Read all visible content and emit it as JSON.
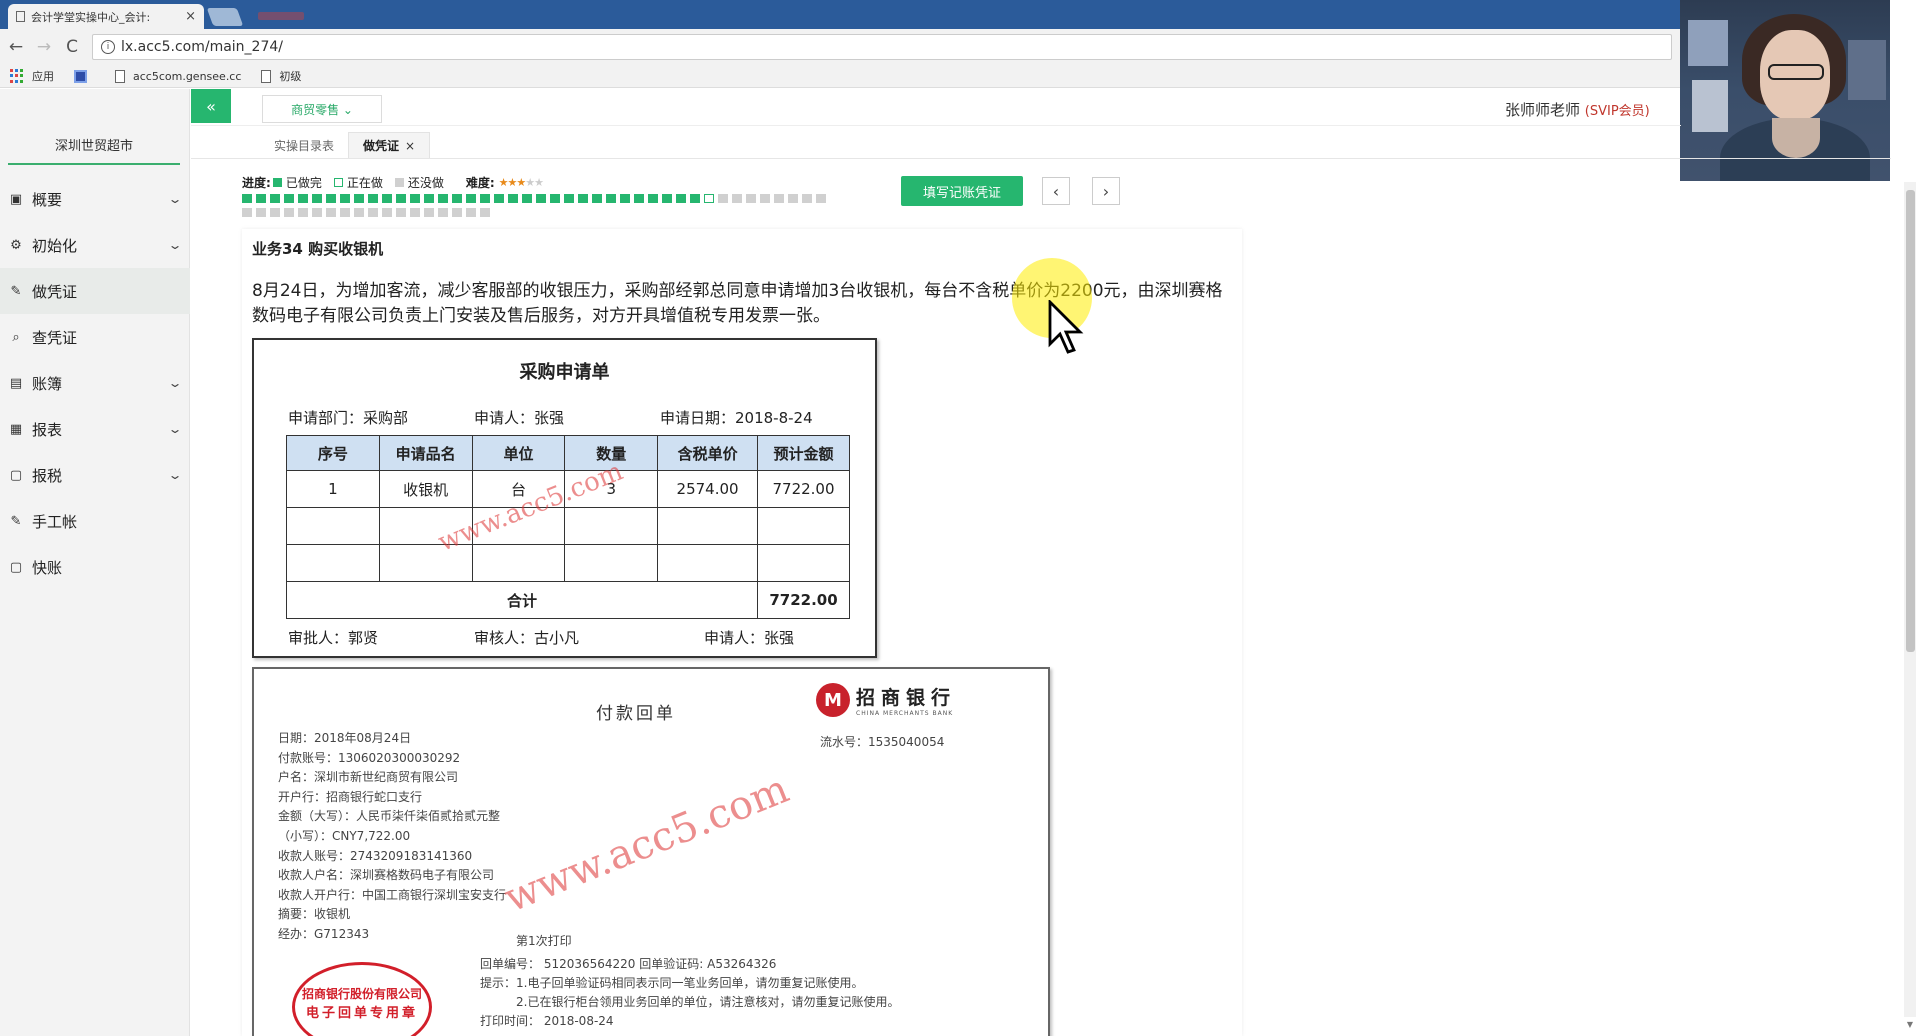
{
  "browser": {
    "tab_title": "会计学堂实操中心_会计:",
    "tab_close": "×",
    "url": "lx.acc5.com/main_274/",
    "back": "←",
    "forward": "→",
    "reload": "C",
    "bookmarks": [
      {
        "label": "应用",
        "icon": "apps-icon"
      },
      {
        "label": "",
        "icon": "square-icon"
      },
      {
        "label": "acc5com.gensee.cc",
        "icon": "page-icon"
      },
      {
        "label": "初级",
        "icon": "page-icon"
      }
    ]
  },
  "sidebar": {
    "company": "深圳世贸超市",
    "items": [
      {
        "label": "概要",
        "icon": "grid-icon",
        "glyph": "▣",
        "expandable": true
      },
      {
        "label": "初始化",
        "icon": "gear-icon",
        "glyph": "⚙",
        "expandable": true
      },
      {
        "label": "做凭证",
        "icon": "pen-icon",
        "glyph": "✎",
        "expandable": false,
        "active": true
      },
      {
        "label": "查凭证",
        "icon": "search-icon",
        "glyph": "⌕",
        "expandable": false
      },
      {
        "label": "账簿",
        "icon": "book-icon",
        "glyph": "▤",
        "expandable": true
      },
      {
        "label": "报表",
        "icon": "report-icon",
        "glyph": "▦",
        "expandable": true
      },
      {
        "label": "报税",
        "icon": "file-icon",
        "glyph": "▢",
        "expandable": true
      },
      {
        "label": "手工帐",
        "icon": "pen-icon",
        "glyph": "✎",
        "expandable": false
      },
      {
        "label": "快账",
        "icon": "file-icon",
        "glyph": "▢",
        "expandable": false
      }
    ]
  },
  "header": {
    "collapse": "«",
    "dropdown": "商贸零售 ⌄",
    "user": "张师师老师",
    "vip": "(SVIP会员)"
  },
  "tabs": [
    {
      "label": "实操目录表",
      "active": false
    },
    {
      "label": "做凭证",
      "active": true,
      "close": "×"
    }
  ],
  "progress": {
    "label": "进度:",
    "legend": [
      "已做完",
      "正在做",
      "还没做"
    ],
    "difficulty_label": "难度:",
    "difficulty": 3,
    "difficulty_max": 5,
    "done_count": 33,
    "current_index": 33,
    "total": 60
  },
  "actions": {
    "fill_voucher": "填写记账凭证",
    "prev": "‹",
    "next": "›"
  },
  "business": {
    "title": "业务34 购买收银机",
    "description": "8月24日，为增加客流，减少客服部的收银压力，采购部经郭总同意申请增加3台收银机，每台不含税单价为2200元，由深圳赛格数码电子有限公司负责上门安装及售后服务，对方开具增值税专用发票一张。"
  },
  "purchase_request": {
    "title": "采购申请单",
    "department": "申请部门：采购部",
    "applicant": "申请人：张强",
    "date": "申请日期：2018-8-24",
    "headers": [
      "序号",
      "申请品名",
      "单位",
      "数量",
      "含税单价",
      "预计金额"
    ],
    "rows": [
      [
        "1",
        "收银机",
        "台",
        "3",
        "2574.00",
        "7722.00"
      ],
      [
        "",
        "",
        "",
        "",
        "",
        ""
      ],
      [
        "",
        "",
        "",
        "",
        "",
        ""
      ]
    ],
    "total_label": "合计",
    "total_value": "7722.00",
    "approver": "审批人：郭贤",
    "reviewer": "审核人：古小凡",
    "requester": "申请人：张强"
  },
  "bank_receipt": {
    "title": "付款回单",
    "bank_name": "招商银行",
    "bank_name_en": "CHINA MERCHANTS BANK",
    "logo_letter": "M",
    "serial": "流水号：1535040054",
    "lines": [
      "日期：2018年08月24日",
      "付款账号：1306020300030292",
      "户名：深圳市新世纪商贸有限公司",
      "开户行：招商银行蛇口支行",
      "金额（大写）：人民币柒仟柒佰贰拾贰元整",
      "（小写）：CNY7,722.00",
      "收款人账号：2743209183141360",
      "收款人户名：深圳赛格数码电子有限公司",
      "收款人开户行：中国工商银行深圳宝安支行",
      "摘要：收银机",
      "经办：G712343"
    ],
    "print_count": "第1次打印",
    "notes": [
      "回单编号： 512036564220 回单验证码: A53264326",
      "提示：1.电子回单验证码相同表示同一笔业务回单，请勿重复记账使用。",
      "　　　2.已在银行柜台领用业务回单的单位，请注意核对，请勿重复记账使用。",
      "打印时间： 2018-08-24"
    ],
    "stamp_line1": "招商银行股份有限公司",
    "stamp_line2": "电子回单专用章"
  },
  "watermark": "www.acc5.com",
  "colors": {
    "accent": "#26b66f",
    "browser_bar": "#2b5b9a",
    "stamp_red": "#d21f2a",
    "vip_red": "#c0362c"
  }
}
